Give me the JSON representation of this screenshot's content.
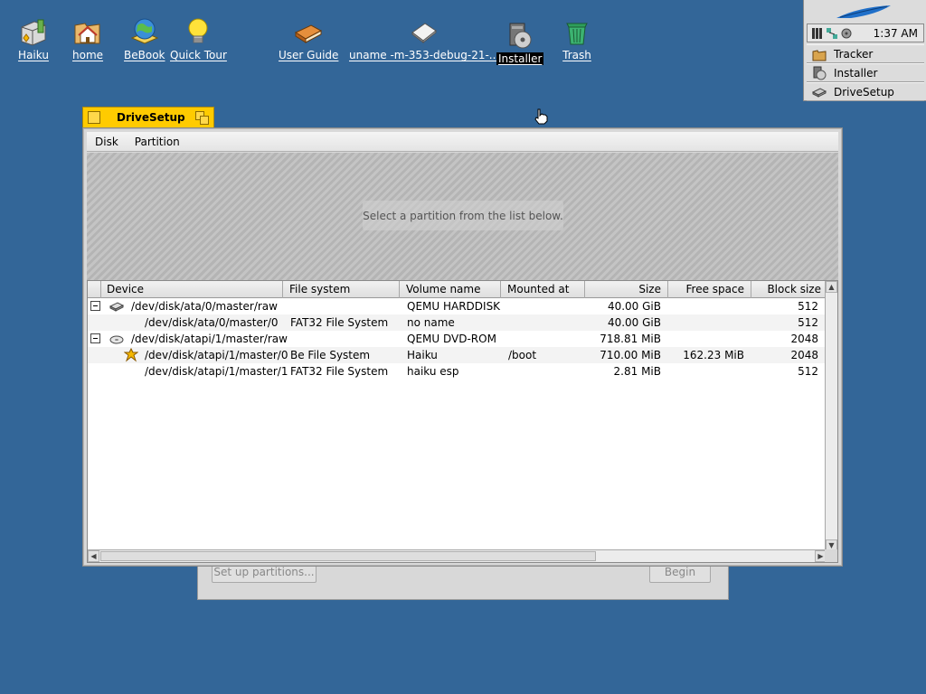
{
  "desktop": {
    "icons": [
      {
        "label": "Haiku",
        "icon": "haiku-volume-icon"
      },
      {
        "label": "home",
        "icon": "home-folder-icon"
      },
      {
        "label": "BeBook",
        "icon": "bebook-icon"
      },
      {
        "label": "Quick Tour",
        "icon": "lightbulb-icon"
      },
      {
        "label": "User Guide",
        "icon": "book-icon"
      },
      {
        "label": "uname -m-353-debug-21-...",
        "icon": "disk-image-icon"
      },
      {
        "label": "Installer",
        "icon": "installer-icon"
      },
      {
        "label": "Trash",
        "icon": "trash-icon"
      }
    ]
  },
  "deskbar": {
    "clock": "1:37 AM",
    "apps": [
      {
        "label": "Tracker",
        "icon": "tracker-icon"
      },
      {
        "label": "Installer",
        "icon": "installer-icon"
      },
      {
        "label": "DriveSetup",
        "icon": "drivesetup-icon"
      }
    ]
  },
  "background_window": {
    "setup_button": "Set up partitions...",
    "begin_button": "Begin"
  },
  "window": {
    "title": "DriveSetup",
    "menus": [
      "Disk",
      "Partition"
    ],
    "placeholder": "Select a partition from the list below.",
    "columns": [
      "Device",
      "File system",
      "Volume name",
      "Mounted at",
      "Size",
      "Free space",
      "Block size"
    ],
    "rows": [
      {
        "device": "/dev/disk/ata/0/master/raw",
        "fs": "",
        "volume": "QEMU HARDDISK",
        "mount": "",
        "size": "40.00 GiB",
        "free": "",
        "block": "512"
      },
      {
        "device": "/dev/disk/ata/0/master/0",
        "fs": "FAT32 File System",
        "volume": "no name",
        "mount": "",
        "size": "40.00 GiB",
        "free": "",
        "block": "512"
      },
      {
        "device": "/dev/disk/atapi/1/master/raw",
        "fs": "",
        "volume": "QEMU DVD-ROM",
        "mount": "",
        "size": "718.81 MiB",
        "free": "",
        "block": "2048"
      },
      {
        "device": "/dev/disk/atapi/1/master/0",
        "fs": "Be File System",
        "volume": "Haiku",
        "mount": "/boot",
        "size": "710.00 MiB",
        "free": "162.23 MiB",
        "block": "2048"
      },
      {
        "device": "/dev/disk/atapi/1/master/1",
        "fs": "FAT32 File System",
        "volume": "haiku esp",
        "mount": "",
        "size": "2.81 MiB",
        "free": "",
        "block": "512"
      }
    ]
  }
}
